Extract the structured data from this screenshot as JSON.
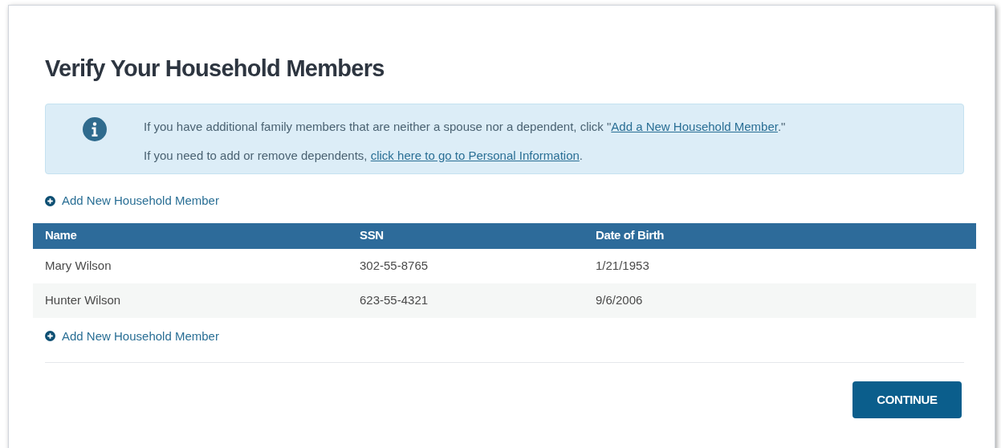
{
  "title": "Verify Your Household Members",
  "info": {
    "lines": [
      {
        "before": "If you have additional family members that are neither a spouse nor a dependent, click \"",
        "link": "Add a New Household Member",
        "after": ".\""
      },
      {
        "before": "If you need to add or remove dependents, ",
        "link": "click here to go to Personal Information",
        "after": "."
      }
    ]
  },
  "add_link_top": "Add New Household Member",
  "table": {
    "columns": [
      "Name",
      "SSN",
      "Date of Birth"
    ],
    "rows": [
      [
        "Mary Wilson",
        "302-55-8765",
        "1/21/1953"
      ],
      [
        "Hunter Wilson",
        "623-55-4321",
        "9/6/2006"
      ]
    ]
  },
  "add_link_bottom": "Add New Household Member",
  "continue_button": "CONTINUE"
}
